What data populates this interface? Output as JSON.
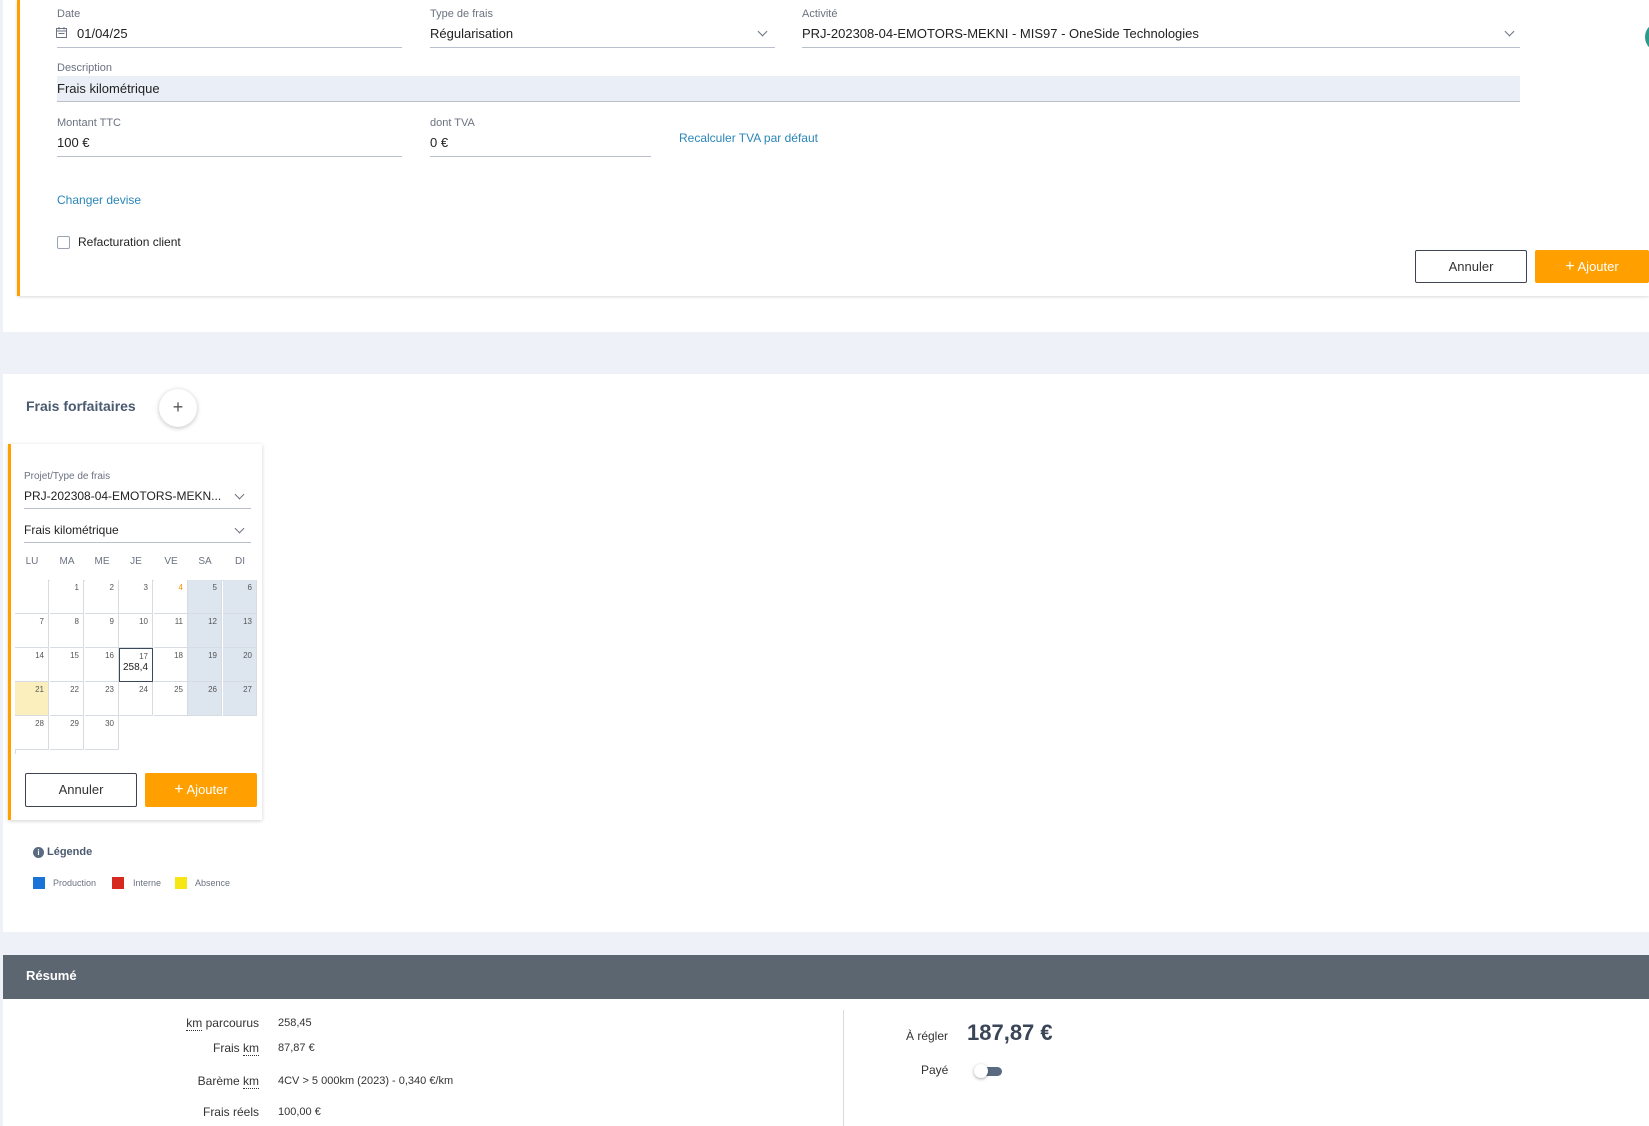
{
  "form": {
    "date_label": "Date",
    "date_value": "01/04/25",
    "type_label": "Type de frais",
    "type_value": "Régularisation",
    "activity_label": "Activité",
    "activity_value": "PRJ-202308-04-EMOTORS-MEKNI - MIS97 - OneSide Technologies",
    "description_label": "Description",
    "description_value": "Frais kilométrique",
    "montant_label": "Montant TTC",
    "montant_value": "100 €",
    "tva_label": "dont TVA",
    "tva_value": "0 €",
    "recalc_link": "Recalculer TVA par défaut",
    "change_currency_link": "Changer devise",
    "refact_label": "Refacturation client",
    "cancel_label": "Annuler",
    "add_label": "Ajouter",
    "accent_color": "#ffa000"
  },
  "forfait": {
    "title": "Frais forfaitaires",
    "add_icon": "plus-icon",
    "project_label": "Projet/Type de frais",
    "project_value": "PRJ-202308-04-EMOTORS-MEKN...",
    "type_value": "Frais kilométrique",
    "weekdays": [
      "LU",
      "MA",
      "ME",
      "JE",
      "VE",
      "SA",
      "DI"
    ],
    "selected_day_value": "258,4",
    "cancel_label": "Annuler",
    "add_label": "Ajouter"
  },
  "legend": {
    "title": "Légende",
    "items": [
      {
        "label": "Production",
        "color": "#1a73d6"
      },
      {
        "label": "Interne",
        "color": "#d62a20"
      },
      {
        "label": "Absence",
        "color": "#f5e614"
      }
    ]
  },
  "summary": {
    "title": "Résumé",
    "rows": [
      {
        "label_pre": "",
        "label_abbr": "km",
        "label_post": " parcourus",
        "value": "258,45"
      },
      {
        "label_pre": "Frais ",
        "label_abbr": "km",
        "label_post": "",
        "value": "87,87 €"
      },
      {
        "label_pre": "Barème ",
        "label_abbr": "km",
        "label_post": "",
        "value": "4CV > 5 000km (2023) - 0,340 €/km"
      },
      {
        "label_pre": "Frais réels",
        "label_abbr": "",
        "label_post": "",
        "value": "100,00 €"
      }
    ],
    "to_pay_label": "À régler",
    "to_pay_value": "187,87 €",
    "paid_label": "Payé"
  }
}
